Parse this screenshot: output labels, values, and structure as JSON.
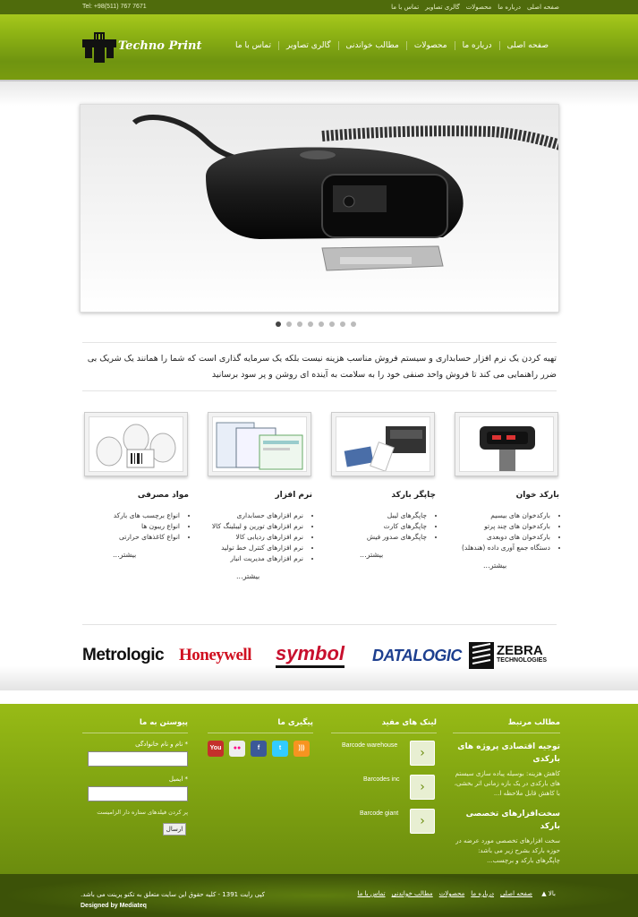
{
  "topbar": {
    "phone": "Tel: +98(511) 767 7671",
    "links": [
      "صفحه اصلی",
      "درباره ما",
      "محصولات",
      "گالری تصاویر",
      "تماس با ما"
    ]
  },
  "header": {
    "logo_text": "Techno Print",
    "nav": [
      "صفحه اصلی",
      "درباره ما",
      "محصولات",
      "مطالب خواندنی",
      "گالری تصاویر",
      "تماس با ما"
    ]
  },
  "slider": {
    "slide_count": 8,
    "active_index": 0
  },
  "intro": {
    "text": "تهیه کردن یک نرم افزار حسابداری و سیستم فروش مناسب هزینه نیست بلکه یک سرمایه گذاری است که شما را همانند یک شریک بی ضرر راهنمایی می کند تا فروش واحد صنفی خود را به سلامت به آینده ای روشن و پر سود برسانید"
  },
  "products": [
    {
      "title": "بارکد خوان",
      "items": [
        "بارکدخوان های بیسیم",
        "بارکدخوان های چند پرتو",
        "بارکدخوان های دوبعدی",
        "دستگاه جمع آوری داده (هندهلد)"
      ],
      "more": "بیشتر..."
    },
    {
      "title": "چاپگر بارکد",
      "items": [
        "چاپگرهای لیبل",
        "چاپگرهای کارت",
        "چاپگرهای صدور فیش"
      ],
      "more": "بیشتر..."
    },
    {
      "title": "نرم افزار",
      "items": [
        "نرم افزارهای حسابداری",
        "نرم افزارهای تورین و لیبلینگ کالا",
        "نرم افزارهای ردیابی کالا",
        "نرم افزارهای کنترل خط تولید",
        "نرم افزارهای مدیریت انبار"
      ],
      "more": "بیشتر..."
    },
    {
      "title": "مواد مصرفی",
      "items": [
        "انواع برچسب های بارکد",
        "انواع ریبون ها",
        "انواع کاغذهای حرارتی"
      ],
      "more": "بیشتر..."
    }
  ],
  "brands": {
    "metrologic": "Metrologic",
    "honeywell": "Honeywell",
    "symbol": "symbol",
    "datalogic": "DATALOGIC",
    "zebra": "ZEBRA",
    "zebra_sub": "TECHNOLOGIES"
  },
  "footer": {
    "related": {
      "heading": "مطالب مرتبط",
      "articles": [
        {
          "title": "توجیه اقتصادی پروژه های بارکدی",
          "text": "کاهش هزینه: بوسیله پیاده سازی سیستم های بارکدی در یک بازه زمانی اثر بخشی، با کاهش قابل ملاحظه ا..."
        },
        {
          "title": "سخت‌افزارهای تخصصی بارکد",
          "text": "سخت افزارهای تخصصی مورد عرضه در حوزه بارکد بشرح زیر می باشد: چاپگرهای بارکد و برچسب..."
        }
      ]
    },
    "links": {
      "heading": "لینک های مفید",
      "items": [
        "Barcode warehouse",
        "Barcodes inc",
        "Barcode giant"
      ]
    },
    "follow": {
      "heading": "پیگیری ما"
    },
    "contact": {
      "heading": "پیوستن به ما",
      "name_label": "* نام و نام خانوادگی",
      "email_label": "* ایمیل",
      "note": "پر کردن فیلدهای ستاره دار الزامیست",
      "send_label": "ارسال"
    }
  },
  "bottom": {
    "nav": [
      "صفحه اصلی",
      "درباره ما",
      "محصولات",
      "مطالب خواندنی",
      "تماس با ما"
    ],
    "copyright": "کپی رایت 1391 - کلیه حقوق این سایت متعلق به تکنو پرینت می باشد.",
    "credit": "Designed by Mediateq",
    "to_top": "بالا"
  },
  "colors": {
    "brand_green": "#7a9c0f",
    "dark_green": "#4f6b0c"
  }
}
